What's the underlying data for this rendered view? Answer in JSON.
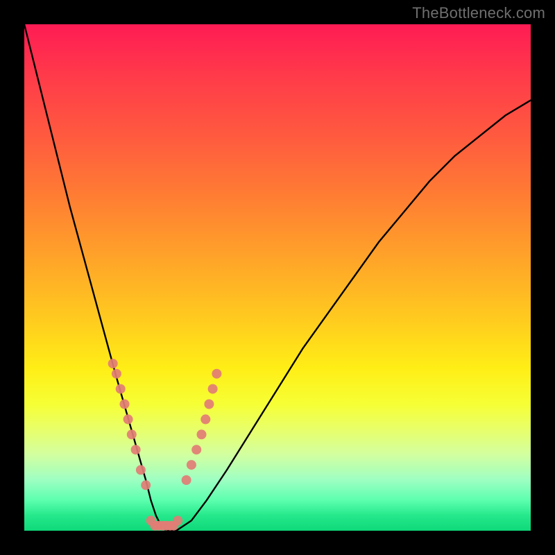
{
  "watermark": "TheBottleneck.com",
  "chart_data": {
    "type": "line",
    "title": "",
    "xlabel": "",
    "ylabel": "",
    "xlim": [
      0,
      100
    ],
    "ylim": [
      0,
      100
    ],
    "grid": false,
    "annotations": [
      "TheBottleneck.com"
    ],
    "series": [
      {
        "name": "curve",
        "x": [
          0,
          3,
          6,
          9,
          12,
          15,
          18,
          20,
          22,
          24,
          25,
          26,
          27,
          28,
          30,
          33,
          36,
          40,
          45,
          50,
          55,
          60,
          65,
          70,
          75,
          80,
          85,
          90,
          95,
          100
        ],
        "y": [
          100,
          88,
          76,
          64,
          53,
          42,
          31,
          24,
          17,
          10,
          6,
          3,
          1,
          0,
          0,
          2,
          6,
          12,
          20,
          28,
          36,
          43,
          50,
          57,
          63,
          69,
          74,
          78,
          82,
          85
        ]
      },
      {
        "name": "dots-left-branch",
        "x": [
          17.5,
          18.2,
          19.0,
          19.8,
          20.5,
          21.2,
          22.0,
          23.0,
          24.0
        ],
        "y": [
          33,
          31,
          28,
          25,
          22,
          19,
          16,
          12,
          9
        ]
      },
      {
        "name": "dots-right-branch",
        "x": [
          32.0,
          33.0,
          34.0,
          35.0,
          35.8,
          36.5,
          37.2,
          38.0
        ],
        "y": [
          10,
          13,
          16,
          19,
          22,
          25,
          28,
          31
        ]
      },
      {
        "name": "dots-valley",
        "x": [
          25.0,
          25.8,
          26.5,
          27.3,
          28.0,
          28.8,
          29.5,
          30.3
        ],
        "y": [
          2,
          1,
          1,
          1,
          1,
          1,
          1,
          2
        ]
      }
    ],
    "colors": {
      "curve": "#000000",
      "dots": "#e27d75",
      "gradient_top": "#ff1b54",
      "gradient_bottom": "#0fd97a"
    }
  }
}
